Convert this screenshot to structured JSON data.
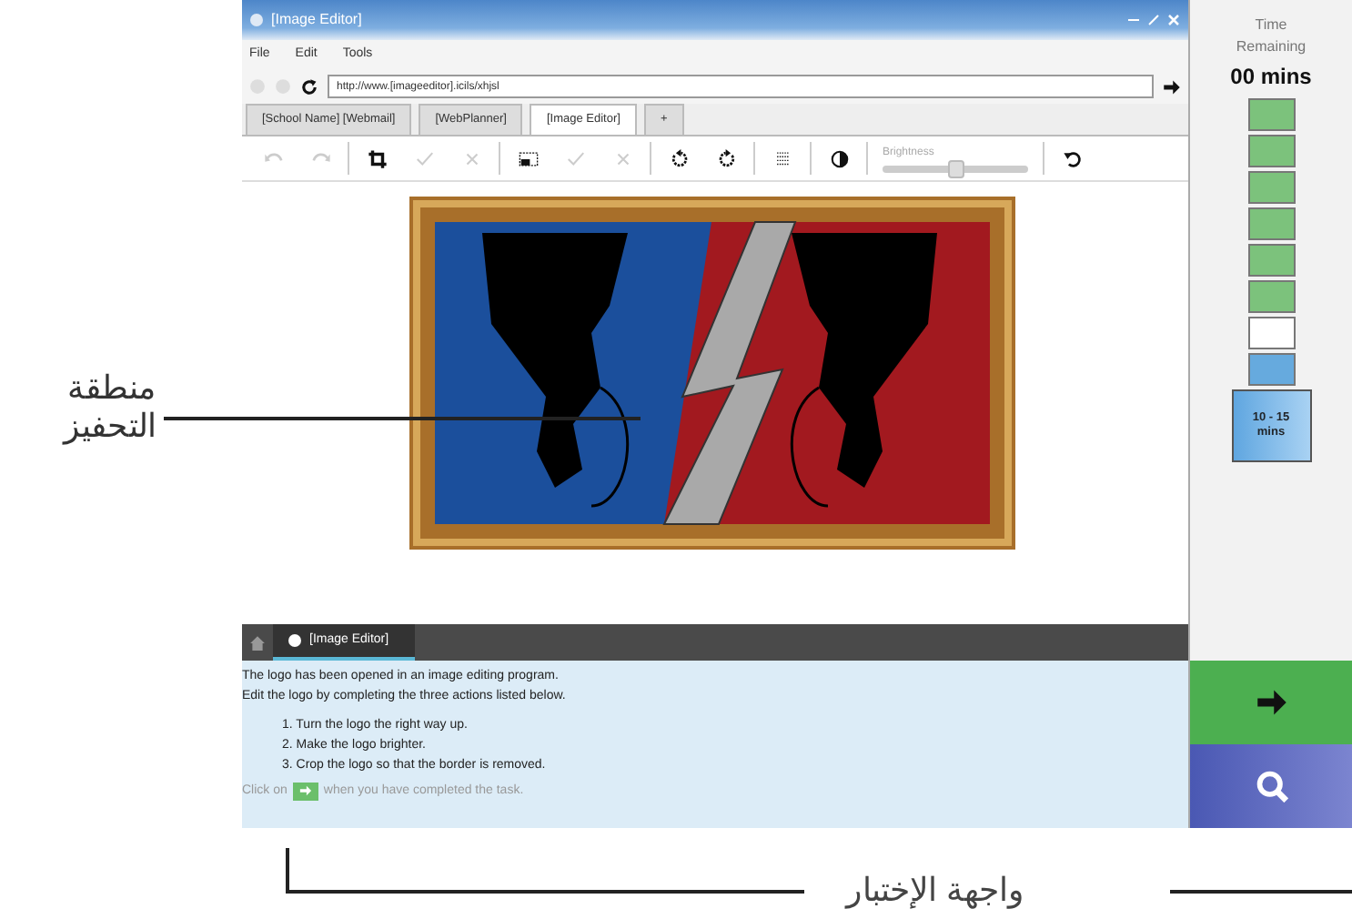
{
  "window": {
    "title": "[Image Editor]"
  },
  "menu": [
    "File",
    "Edit",
    "Tools"
  ],
  "address_bar": {
    "url": "http://www.[imageeditor].icils/xhjsl"
  },
  "tabs": [
    {
      "label": "[School Name] [Webmail]",
      "selected": false
    },
    {
      "label": "[WebPlanner]",
      "selected": false
    },
    {
      "label": "[Image Editor]",
      "selected": true
    },
    {
      "label": "+",
      "selected": false
    }
  ],
  "toolbar": [
    {
      "kind": "undo",
      "disabled": true
    },
    {
      "kind": "redo",
      "disabled": true
    },
    {
      "kind": "sep"
    },
    {
      "kind": "crop",
      "disabled": false
    },
    {
      "kind": "check",
      "disabled": true
    },
    {
      "kind": "cross",
      "disabled": true
    },
    {
      "kind": "sep"
    },
    {
      "kind": "select",
      "disabled": false
    },
    {
      "kind": "check",
      "disabled": true
    },
    {
      "kind": "cross",
      "disabled": true
    },
    {
      "kind": "sep"
    },
    {
      "kind": "rotleft",
      "disabled": false
    },
    {
      "kind": "rotright",
      "disabled": false
    },
    {
      "kind": "sep"
    },
    {
      "kind": "grid",
      "disabled": false
    },
    {
      "kind": "sep"
    },
    {
      "kind": "contrast",
      "disabled": false
    },
    {
      "kind": "sep"
    },
    {
      "kind": "slider",
      "label": "Brightness",
      "level": 0.5
    },
    {
      "kind": "sep"
    },
    {
      "kind": "reset",
      "disabled": false
    }
  ],
  "task_panel": {
    "tab": "[Image Editor]",
    "intro": [
      "The logo has been opened in an image editing program.",
      "Edit the logo by completing the three actions listed below."
    ],
    "steps": [
      {
        "number": "1.",
        "text": "Turn the logo the right way up."
      },
      {
        "number": "2.",
        "text": "Make the logo brighter."
      },
      {
        "number": "3.",
        "text": "Crop the logo so that the border is removed."
      }
    ],
    "footer_before": "Click on",
    "footer_after": "when you have completed the task."
  },
  "timer": {
    "heading": [
      "Time",
      "Remaining"
    ],
    "value": "00 mins",
    "segments": [
      {
        "color": "#7cc27c"
      },
      {
        "color": "#7cc27c"
      },
      {
        "color": "#7cc27c"
      },
      {
        "color": "#7cc27c"
      },
      {
        "color": "#7cc27c"
      },
      {
        "color": "#7cc27c"
      },
      {
        "color": "#ffffff"
      },
      {
        "color": "#66aade"
      }
    ],
    "current_label": "10 - 15 mins"
  },
  "annotations": {
    "side_label": "منطقة التحفيز",
    "bottom_label": "واجهة الإختبار"
  }
}
